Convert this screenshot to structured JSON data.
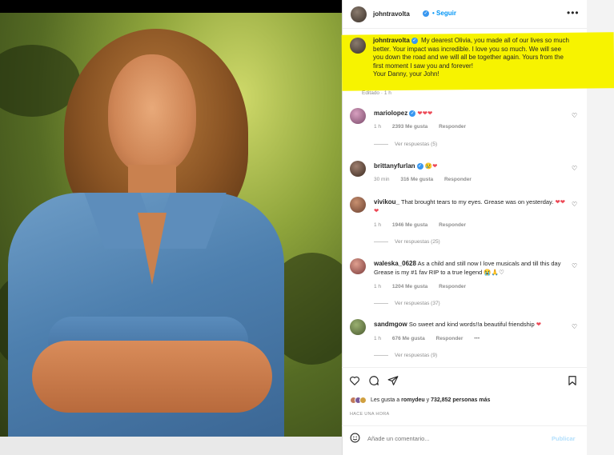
{
  "post": {
    "author": "johntravolta",
    "follow_label": "Seguir",
    "more_icon": "more-horizontal-icon",
    "caption_author": "johntravolta",
    "caption_text": "My dearest Olivia, you made all of our lives so much better. Your impact was incredible. I love you so much. We will see you down the road and we will all be together again. Yours from the first moment I saw you and forever!",
    "caption_signoff": "Your Danny, your John!",
    "edited_label": "Editado · 1 h"
  },
  "comments": [
    {
      "user": "mariolopez",
      "verified": true,
      "text": "",
      "hearts": "❤❤❤",
      "time": "1 h",
      "likes": "2393 Me gusta",
      "reply": "Responder",
      "replies": "Ver respuestas (5)"
    },
    {
      "user": "brittanyfurlan",
      "verified": true,
      "text": "",
      "hearts": "😢❤",
      "time": "30 min",
      "likes": "316 Me gusta",
      "reply": "Responder",
      "replies": ""
    },
    {
      "user": "vivikou_",
      "verified": false,
      "text": "That brought tears to my eyes. Grease was on yesterday.",
      "hearts": "❤❤❤",
      "time": "1 h",
      "likes": "1946 Me gusta",
      "reply": "Responder",
      "replies": "Ver respuestas (25)"
    },
    {
      "user": "waleska_0628",
      "verified": false,
      "text": "As a child and still now I love musicals and till this day Grease is my #1 fav RIP to a true legend 😭🙏♡",
      "hearts": "",
      "time": "1 h",
      "likes": "1204 Me gusta",
      "reply": "Responder",
      "replies": "Ver respuestas (37)"
    },
    {
      "user": "sandmgow",
      "verified": false,
      "text": "So sweet and kind words!!a beautiful friendship",
      "hearts": "❤",
      "time": "1 h",
      "likes": "676 Me gusta",
      "reply": "Responder",
      "replies": "Ver respuestas (9)"
    }
  ],
  "actions": {
    "like_icon": "heart-outline-icon",
    "comment_icon": "comment-bubble-icon",
    "share_icon": "paper-plane-icon",
    "save_icon": "bookmark-icon",
    "likes_prefix": "Les gusta a",
    "likes_user": "romydeu",
    "likes_middle": "y",
    "likes_count": "732,852 personas más",
    "time_ago": "HACE UNA HORA"
  },
  "comment_box": {
    "placeholder": "Añade un comentario...",
    "post_label": "Publicar",
    "emoji_icon": "smiley-face-icon"
  },
  "colors": {
    "highlight": "#f7f300",
    "verified": "#3897f0",
    "link": "#0095f6",
    "heart_red": "#ed4956",
    "post_disabled": "#b2dffc"
  }
}
